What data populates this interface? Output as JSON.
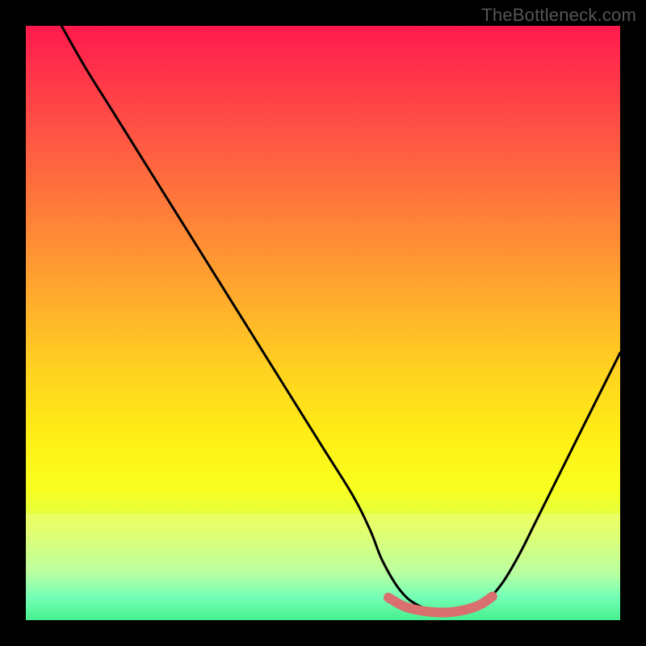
{
  "watermark": "TheBottleneck.com",
  "colors": {
    "frame": "#000000",
    "gradient_top": "#ff1a4d",
    "gradient_bottom": "#00e97a",
    "curve": "#000000",
    "valley_stroke": "#d9706e"
  },
  "chart_data": {
    "type": "line",
    "title": "",
    "xlabel": "",
    "ylabel": "",
    "xlim": [
      0,
      100
    ],
    "ylim": [
      0,
      100
    ],
    "grid": false,
    "legend": null,
    "description": "Bottleneck curve falling steeply from upper-left to a flat valley around x≈63–77, then rising toward the right edge. A short pink segment marks the valley floor.",
    "series": [
      {
        "name": "bottleneck-curve",
        "x": [
          6,
          10,
          15,
          20,
          25,
          30,
          35,
          40,
          45,
          50,
          55,
          58,
          60,
          63,
          66,
          70,
          74,
          77,
          80,
          83,
          86,
          90,
          94,
          98,
          100
        ],
        "y": [
          100,
          93,
          85,
          77,
          69,
          61,
          53,
          45,
          37,
          29,
          21,
          15,
          10,
          5,
          2.5,
          1.3,
          1.3,
          2.8,
          6,
          11,
          17,
          25,
          33,
          41,
          45
        ]
      },
      {
        "name": "valley-highlight",
        "x": [
          61,
          64,
          68,
          72,
          76,
          78.5
        ],
        "y": [
          3.8,
          2.2,
          1.4,
          1.4,
          2.4,
          4.0
        ]
      }
    ],
    "highlight_band_y": [
      0,
      18
    ]
  }
}
